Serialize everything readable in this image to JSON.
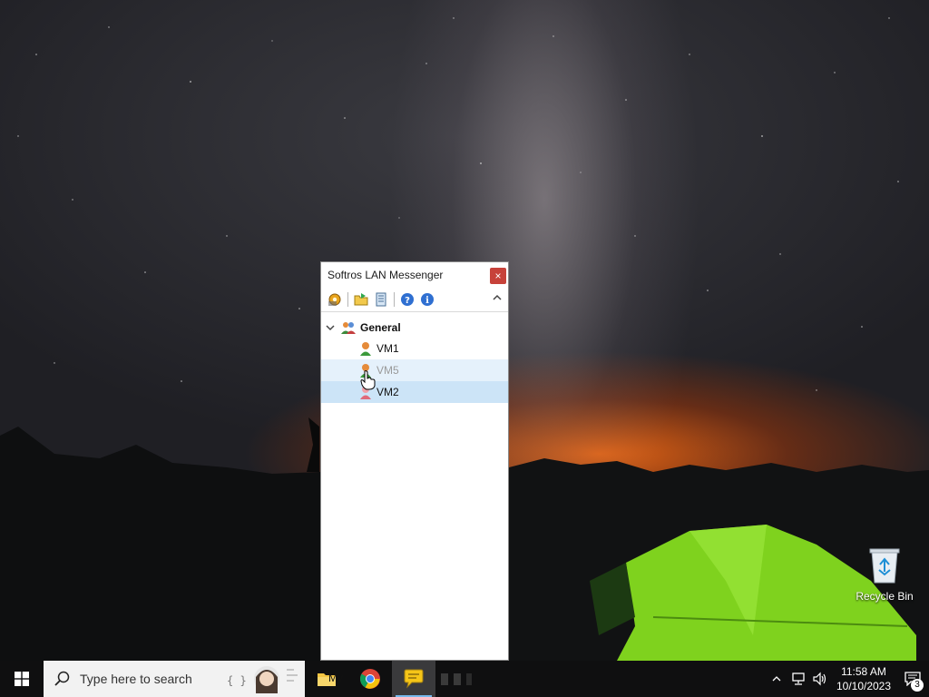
{
  "desktop": {
    "recycle_bin_label": "Recycle Bin"
  },
  "messenger": {
    "title": "Softros LAN Messenger",
    "close_label": "×",
    "toolbar": {
      "icons": [
        "settings-icon",
        "open-folder-icon",
        "message-history-icon",
        "help-icon",
        "info-icon"
      ]
    },
    "group": {
      "name": "General",
      "users": [
        {
          "name": "VM1",
          "state": "normal"
        },
        {
          "name": "VM5",
          "state": "hover"
        },
        {
          "name": "VM2",
          "state": "selected"
        }
      ]
    }
  },
  "taskbar": {
    "search_placeholder": "Type here to search",
    "explorer_label": "My",
    "clock_time": "11:58 AM",
    "clock_date": "10/10/2023",
    "notification_count": "3",
    "accent": "#76b9ed"
  }
}
